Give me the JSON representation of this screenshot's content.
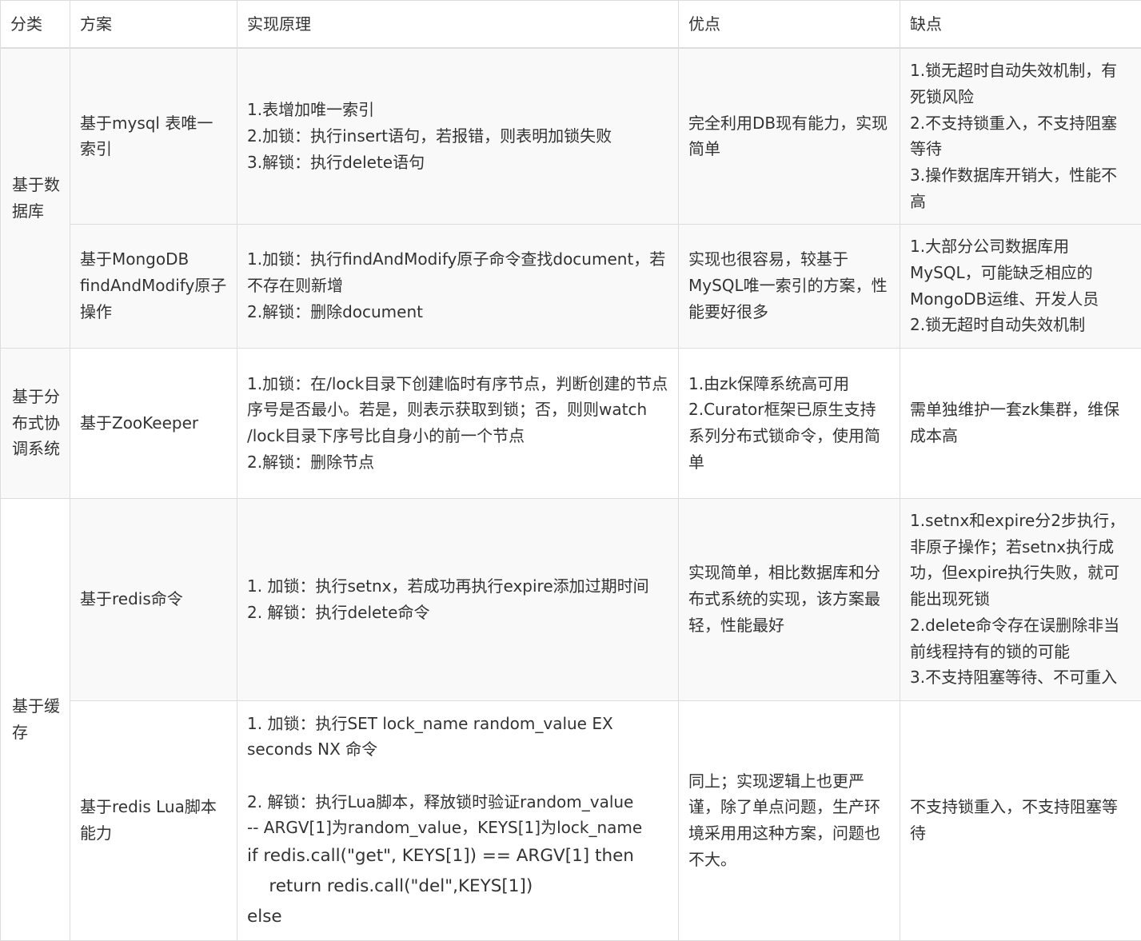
{
  "headers": {
    "category": "分类",
    "scheme": "方案",
    "principle": "实现原理",
    "pros": "优点",
    "cons": "缺点"
  },
  "categories": {
    "database": "基于数据库",
    "coordination": "基于分布式协调系统",
    "cache": "基于缓存"
  },
  "rows": {
    "mysql": {
      "scheme": "基于mysql 表唯一索引",
      "principle": [
        "1.表增加唯一索引",
        "2.加锁：执行insert语句，若报错，则表明加锁失败",
        "3.解锁：执行delete语句"
      ],
      "pros": "完全利用DB现有能力，实现简单",
      "cons": [
        "1.锁无超时自动失效机制，有死锁风险",
        "2.不支持锁重入，不支持阻塞等待",
        "3.操作数据库开销大，性能不高"
      ]
    },
    "mongodb": {
      "scheme": "基于MongoDB findAndModify原子操作",
      "principle": [
        "1.加锁：执行findAndModify原子命令查找document，若不存在则新增",
        "2.解锁：删除document"
      ],
      "pros": "实现也很容易，较基于MySQL唯一索引的方案，性能要好很多",
      "cons": [
        "1.大部分公司数据库用MySQL，可能缺乏相应的MongoDB运维、开发人员",
        "2.锁无超时自动失效机制"
      ]
    },
    "zookeeper": {
      "scheme": "基于ZooKeeper",
      "principle": [
        "1.加锁：在/lock目录下创建临时有序节点，判断创建的节点序号是否最小。若是，则表示获取到锁；否，则则watch /lock目录下序号比自身小的前一个节点",
        "2.解锁：删除节点"
      ],
      "pros": [
        "1.由zk保障系统高可用",
        "2.Curator框架已原生支持系列分布式锁命令，使用简单"
      ],
      "cons": "需单独维护一套zk集群，维保成本高"
    },
    "redis_cmd": {
      "scheme": "基于redis命令",
      "principle": [
        "1. 加锁：执行setnx，若成功再执行expire添加过期时间",
        "2. 解锁：执行delete命令"
      ],
      "pros": "实现简单，相比数据库和分布式系统的实现，该方案最轻，性能最好",
      "cons": [
        "1.setnx和expire分2步执行，非原子操作；若setnx执行成功，但expire执行失败，就可能出现死锁",
        "2.delete命令存在误删除非当前线程持有的锁的可能",
        "3.不支持阻塞等待、不可重入"
      ]
    },
    "redis_lua": {
      "scheme": "基于redis Lua脚本能力",
      "principle_text": [
        "1. 加锁：执行SET lock_name random_value EX seconds NX 命令",
        "2. 解锁：执行Lua脚本，释放锁时验证random_value",
        "-- ARGV[1]为random_value，KEYS[1]为lock_name"
      ],
      "principle_code": [
        "if redis.call(\"get\", KEYS[1]) == ARGV[1] then",
        "    return redis.call(\"del\",KEYS[1])",
        "else"
      ],
      "pros": "同上；实现逻辑上也更严谨，除了单点问题，生产环境采用用这种方案，问题也不大。",
      "cons": "不支持锁重入，不支持阻塞等待"
    }
  }
}
